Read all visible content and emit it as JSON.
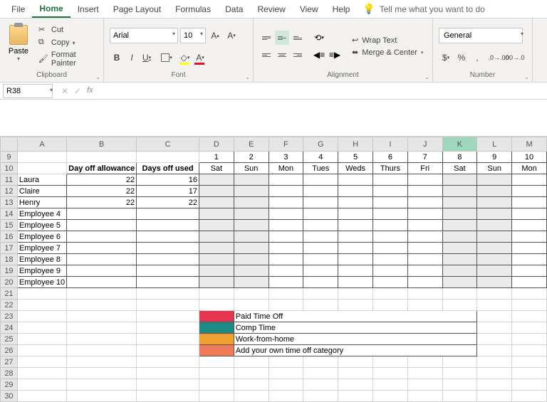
{
  "tabs": [
    "File",
    "Home",
    "Insert",
    "Page Layout",
    "Formulas",
    "Data",
    "Review",
    "View",
    "Help"
  ],
  "active_tab": "Home",
  "tell_me": "Tell me what you want to do",
  "clipboard": {
    "paste": "Paste",
    "cut": "Cut",
    "copy": "Copy",
    "format_painter": "Format Painter",
    "label": "Clipboard"
  },
  "font": {
    "name": "Arial",
    "size": "10",
    "label": "Font"
  },
  "alignment": {
    "wrap": "Wrap Text",
    "merge": "Merge & Center",
    "label": "Alignment"
  },
  "number": {
    "format": "General",
    "label": "Number"
  },
  "name_box": "R38",
  "cols": [
    "A",
    "B",
    "C",
    "D",
    "E",
    "F",
    "G",
    "H",
    "I",
    "J",
    "K",
    "L",
    "M"
  ],
  "row_start": 9,
  "row_end": 30,
  "headers": {
    "allowance": "Day off allowance",
    "used": "Days off used"
  },
  "day_headers": [
    "Sat",
    "Sun",
    "Mon",
    "Tues",
    "Weds",
    "Thurs",
    "Fri",
    "Sat",
    "Sun",
    "Mon"
  ],
  "day_nums": [
    "1",
    "2",
    "3",
    "4",
    "5",
    "6",
    "7",
    "8",
    "9",
    "10"
  ],
  "employees": [
    {
      "name": "Laura",
      "allow": "22",
      "used": "16"
    },
    {
      "name": "Claire",
      "allow": "22",
      "used": "17"
    },
    {
      "name": "Henry",
      "allow": "22",
      "used": "22"
    },
    {
      "name": "Employee 4",
      "allow": "",
      "used": ""
    },
    {
      "name": "Employee 5",
      "allow": "",
      "used": ""
    },
    {
      "name": "Employee 6",
      "allow": "",
      "used": ""
    },
    {
      "name": "Employee 7",
      "allow": "",
      "used": ""
    },
    {
      "name": "Employee 8",
      "allow": "",
      "used": ""
    },
    {
      "name": "Employee 9",
      "allow": "",
      "used": ""
    },
    {
      "name": "Employee 10",
      "allow": "",
      "used": ""
    }
  ],
  "legend": [
    {
      "color": "leg-red",
      "label": "Paid Time Off"
    },
    {
      "color": "leg-teal",
      "label": "Comp Time"
    },
    {
      "color": "leg-orange",
      "label": "Work-from-home"
    },
    {
      "color": "leg-salmon",
      "label": "Add your own time off category"
    }
  ]
}
